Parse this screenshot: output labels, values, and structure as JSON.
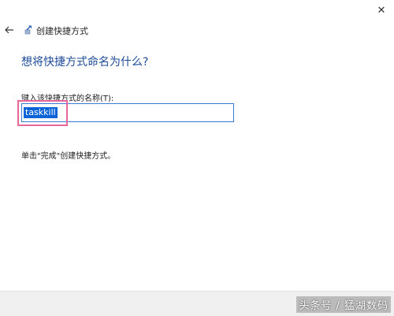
{
  "window": {
    "close_glyph": "✕"
  },
  "header": {
    "title": "创建快捷方式"
  },
  "main": {
    "heading": "想将快捷方式命名为什么?",
    "field_label": "键入该快捷方式的名称(T):",
    "name_value": "taskkill",
    "hint": "单击\"完成\"创建快捷方式。"
  },
  "footer": {
    "watermark": "头条号 / 猛湖数码"
  },
  "colors": {
    "heading": "#1e4b9a",
    "input_border": "#3a7bd5",
    "selection": "#0a64d8",
    "annotation_box": "#e8669a"
  }
}
